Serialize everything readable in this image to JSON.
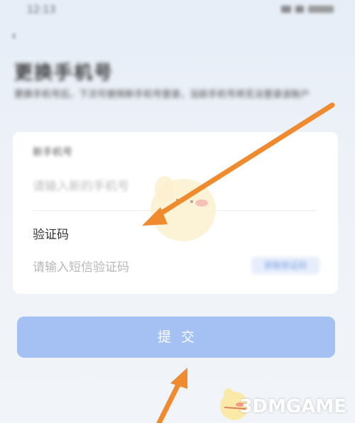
{
  "status_bar": {
    "time": "12:13"
  },
  "page": {
    "title": "更换手机号",
    "description": "更换手机号后，下次可使用新手机号登录，当前手机号将无法登录该账户"
  },
  "form": {
    "phone_label": "新手机号",
    "phone_placeholder": "请输入新的手机号",
    "code_label": "验证码",
    "code_placeholder": "请输入短信验证码",
    "get_code_label": "获取验证码"
  },
  "submit": {
    "label": "提交"
  },
  "watermark": {
    "brand": "3DMGAME"
  },
  "colors": {
    "accent": "#a5c0f3",
    "arrow": "#f08a2e",
    "background": "#e9eff8"
  }
}
